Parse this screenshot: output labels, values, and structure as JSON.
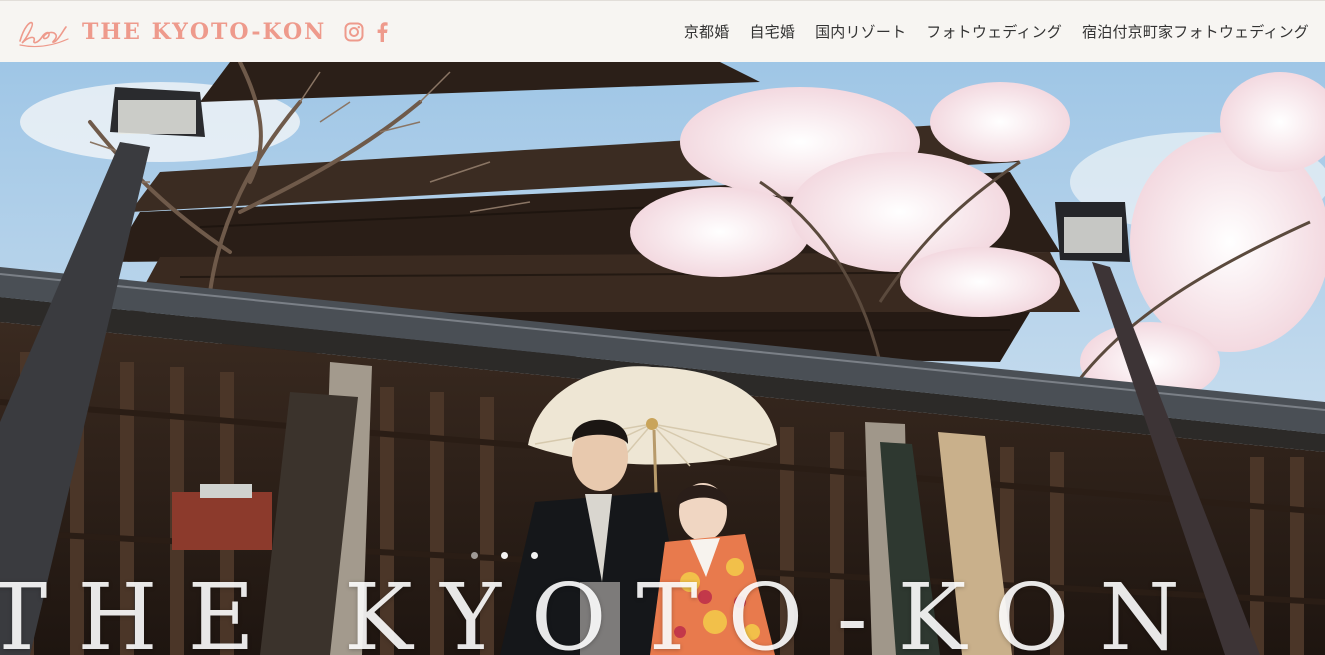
{
  "header": {
    "brand_name": "THE KYOTO-KON",
    "brand_color": "#ee9a8c",
    "logo_icon": "kyotokon-script-logo-icon",
    "social": [
      {
        "icon": "instagram-icon"
      },
      {
        "icon": "facebook-icon"
      }
    ],
    "nav": [
      {
        "label": "京都婚"
      },
      {
        "label": "自宅婚"
      },
      {
        "label": "国内リゾート"
      },
      {
        "label": "フォトウェディング"
      },
      {
        "label": "宿泊付京町家フォトウェディング"
      }
    ]
  },
  "hero": {
    "wordmark": "THE KYOTO-KON",
    "slides_total": 3,
    "active_slide": 1
  }
}
